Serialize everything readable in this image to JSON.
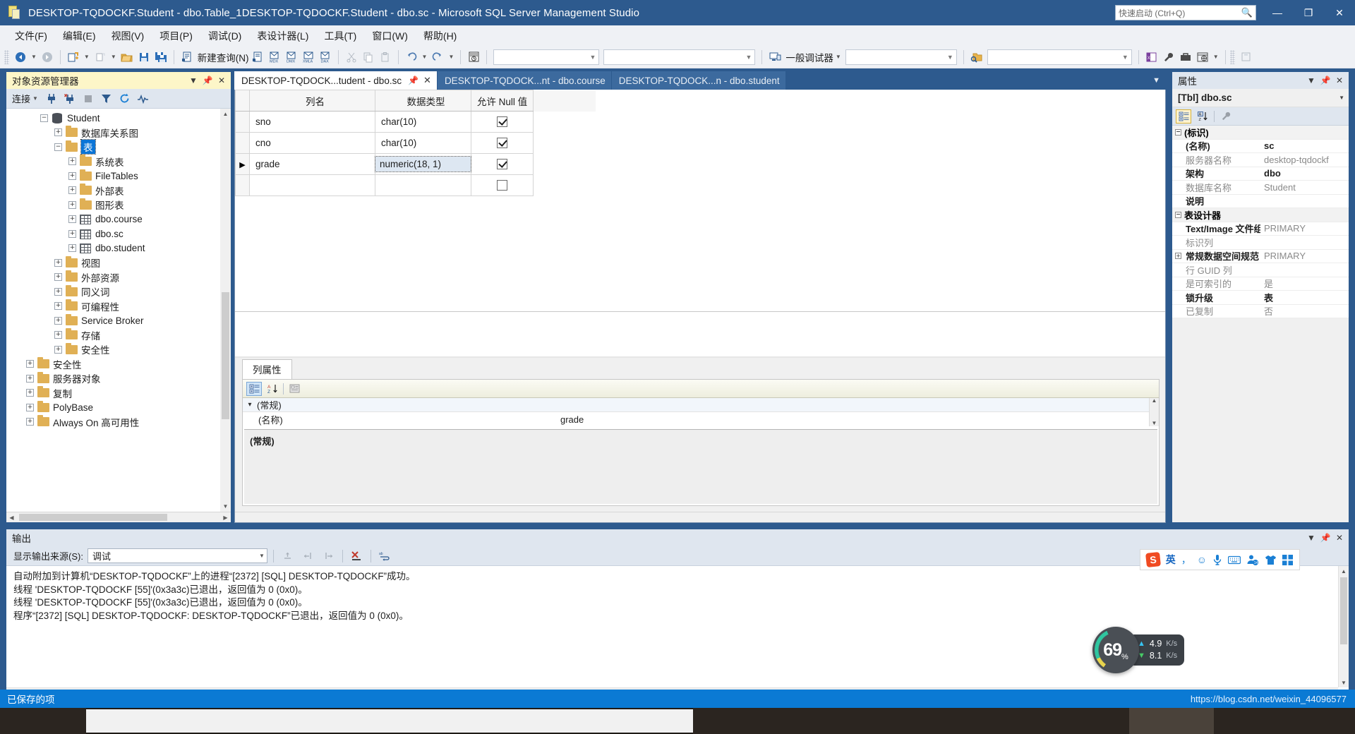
{
  "window": {
    "title": "DESKTOP-TQDOCKF.Student - dbo.Table_1DESKTOP-TQDOCKF.Student - dbo.sc - Microsoft SQL Server Management Studio",
    "app_icon": "ssms-icon",
    "quick_launch_placeholder": "快速启动 (Ctrl+Q)",
    "minimize": "—",
    "maximize": "❐",
    "close": "✕"
  },
  "menubar": {
    "items": [
      {
        "label": "文件(F)",
        "name": "menu-file"
      },
      {
        "label": "编辑(E)",
        "name": "menu-edit"
      },
      {
        "label": "视图(V)",
        "name": "menu-view"
      },
      {
        "label": "项目(P)",
        "name": "menu-project"
      },
      {
        "label": "调试(D)",
        "name": "menu-debug"
      },
      {
        "label": "表设计器(L)",
        "name": "menu-table-designer"
      },
      {
        "label": "工具(T)",
        "name": "menu-tools"
      },
      {
        "label": "窗口(W)",
        "name": "menu-window"
      },
      {
        "label": "帮助(H)",
        "name": "menu-help"
      }
    ]
  },
  "toolbar": {
    "new_query_label": "新建查询(N)",
    "mdx_label": "MDX",
    "dmx_label": "DMX",
    "xmla_label": "XMLA",
    "dax_label": "DAX",
    "debugger_label": "一般调试器",
    "combo1_value": "",
    "combo2_value": "",
    "combo3_value": "",
    "combo4_value": ""
  },
  "object_explorer": {
    "title": "对象资源管理器",
    "connect_label": "连接",
    "tree": [
      {
        "label": "Student",
        "indent": 2,
        "expander": "minus",
        "icon": "database-icon",
        "selected": false
      },
      {
        "label": "数据库关系图",
        "indent": 3,
        "expander": "plus",
        "icon": "folder-icon",
        "selected": false
      },
      {
        "label": "表",
        "indent": 3,
        "expander": "minus",
        "icon": "folder-icon",
        "selected": true
      },
      {
        "label": "系统表",
        "indent": 4,
        "expander": "plus",
        "icon": "folder-icon",
        "selected": false
      },
      {
        "label": "FileTables",
        "indent": 4,
        "expander": "plus",
        "icon": "folder-icon",
        "selected": false
      },
      {
        "label": "外部表",
        "indent": 4,
        "expander": "plus",
        "icon": "folder-icon",
        "selected": false
      },
      {
        "label": "图形表",
        "indent": 4,
        "expander": "plus",
        "icon": "folder-icon",
        "selected": false
      },
      {
        "label": "dbo.course",
        "indent": 4,
        "expander": "plus",
        "icon": "table-icon",
        "selected": false
      },
      {
        "label": "dbo.sc",
        "indent": 4,
        "expander": "plus",
        "icon": "table-icon",
        "selected": false
      },
      {
        "label": "dbo.student",
        "indent": 4,
        "expander": "plus",
        "icon": "table-icon",
        "selected": false
      },
      {
        "label": "视图",
        "indent": 3,
        "expander": "plus",
        "icon": "folder-icon",
        "selected": false
      },
      {
        "label": "外部资源",
        "indent": 3,
        "expander": "plus",
        "icon": "folder-icon",
        "selected": false
      },
      {
        "label": "同义词",
        "indent": 3,
        "expander": "plus",
        "icon": "folder-icon",
        "selected": false
      },
      {
        "label": "可编程性",
        "indent": 3,
        "expander": "plus",
        "icon": "folder-icon",
        "selected": false
      },
      {
        "label": "Service Broker",
        "indent": 3,
        "expander": "plus",
        "icon": "folder-icon",
        "selected": false
      },
      {
        "label": "存储",
        "indent": 3,
        "expander": "plus",
        "icon": "folder-icon",
        "selected": false
      },
      {
        "label": "安全性",
        "indent": 3,
        "expander": "plus",
        "icon": "folder-icon",
        "selected": false
      },
      {
        "label": "安全性",
        "indent": 1,
        "expander": "plus",
        "icon": "folder-icon",
        "selected": false
      },
      {
        "label": "服务器对象",
        "indent": 1,
        "expander": "plus",
        "icon": "folder-icon",
        "selected": false
      },
      {
        "label": "复制",
        "indent": 1,
        "expander": "plus",
        "icon": "folder-icon",
        "selected": false
      },
      {
        "label": "PolyBase",
        "indent": 1,
        "expander": "plus",
        "icon": "folder-icon",
        "selected": false
      },
      {
        "label": "Always On 高可用性",
        "indent": 1,
        "expander": "plus",
        "icon": "folder-icon",
        "selected": false
      }
    ]
  },
  "document_tabs": [
    {
      "label": "DESKTOP-TQDOCK...tudent - dbo.sc",
      "active": true,
      "name": "tab-dbo-sc"
    },
    {
      "label": "DESKTOP-TQDOCK...nt - dbo.course",
      "active": false,
      "name": "tab-dbo-course"
    },
    {
      "label": "DESKTOP-TQDOCK...n - dbo.student",
      "active": false,
      "name": "tab-dbo-student"
    }
  ],
  "designer": {
    "headers": {
      "col_name": "列名",
      "data_type": "数据类型",
      "allow_nulls": "允许 Null 值"
    },
    "rows": [
      {
        "marker": "",
        "name": "sno",
        "type": "char(10)",
        "nullable": true,
        "editing": false
      },
      {
        "marker": "",
        "name": "cno",
        "type": "char(10)",
        "nullable": true,
        "editing": false
      },
      {
        "marker": "▶",
        "name": "grade",
        "type": "numeric(18, 1)",
        "nullable": true,
        "editing": true
      },
      {
        "marker": "",
        "name": "",
        "type": "",
        "nullable": false,
        "editing": false
      }
    ]
  },
  "column_properties": {
    "tab_label": "列属性",
    "category": "(常规)",
    "rows": [
      {
        "key": "(名称)",
        "value": "grade"
      }
    ],
    "description_title": "(常规)",
    "description_body": ""
  },
  "properties_panel": {
    "title": "属性",
    "object": "[Tbl] dbo.sc",
    "groups": [
      {
        "name": "(标识)",
        "expander": "minus",
        "rows": [
          {
            "key": "(名称)",
            "value": "sc",
            "key_bold": true,
            "value_bold": true
          },
          {
            "key": "服务器名称",
            "value": "desktop-tqdockf",
            "key_bold": false,
            "value_bold": false
          },
          {
            "key": "架构",
            "value": "dbo",
            "key_bold": true,
            "value_bold": true
          },
          {
            "key": "数据库名称",
            "value": "Student",
            "key_bold": false,
            "value_bold": false
          },
          {
            "key": "说明",
            "value": "",
            "key_bold": true,
            "value_bold": false
          }
        ]
      },
      {
        "name": "表设计器",
        "expander": "minus",
        "rows": [
          {
            "key": "Text/Image 文件组",
            "value": "PRIMARY",
            "key_bold": true,
            "value_bold": false
          },
          {
            "key": "标识列",
            "value": "",
            "key_bold": false,
            "value_bold": false
          },
          {
            "key": "常规数据空间规范",
            "value": "PRIMARY",
            "key_bold": true,
            "value_bold": false,
            "expander": "plus"
          },
          {
            "key": "行 GUID 列",
            "value": "",
            "key_bold": false,
            "value_bold": false
          },
          {
            "key": "是可索引的",
            "value": "是",
            "key_bold": false,
            "value_bold": false
          },
          {
            "key": "锁升级",
            "value": "表",
            "key_bold": true,
            "value_bold": true
          },
          {
            "key": "已复制",
            "value": "否",
            "key_bold": false,
            "value_bold": false
          }
        ]
      }
    ]
  },
  "output_panel": {
    "title": "输出",
    "source_label": "显示输出来源(S):",
    "source_value": "调试",
    "lines": [
      "自动附加到计算机“DESKTOP-TQDOCKF”上的进程“[2372] [SQL] DESKTOP-TQDOCKF”成功。",
      "线程 'DESKTOP-TQDOCKF [55]'(0x3a3c)已退出，返回值为 0 (0x0)。",
      "线程 'DESKTOP-TQDOCKF [55]'(0x3a3c)已退出，返回值为 0 (0x0)。",
      "程序“[2372] [SQL] DESKTOP-TQDOCKF: DESKTOP-TQDOCKF”已退出，返回值为 0 (0x0)。"
    ]
  },
  "statusbar": {
    "text": "已保存的项",
    "watermark": "https://blog.csdn.net/weixin_44096577"
  },
  "ime_bar": {
    "logo": "S",
    "mode": "英",
    "punct": "，",
    "emoji": "☺",
    "mic": "🎤",
    "keyboard": "⌨",
    "user": "user-icon",
    "skin": "skin-icon",
    "grid": "grid-icon"
  },
  "speed_widget": {
    "percent": "69",
    "percent_unit": "%",
    "upload": "4.9",
    "upload_unit": "K/s",
    "download": "8.1",
    "download_unit": "K/s"
  },
  "colors": {
    "title_bar": "#2d5a8e",
    "status_bar": "#0b7ad4",
    "oe_header": "#fdf6c8",
    "selection": "#0b75d7",
    "accent": "#2d5a8e"
  }
}
